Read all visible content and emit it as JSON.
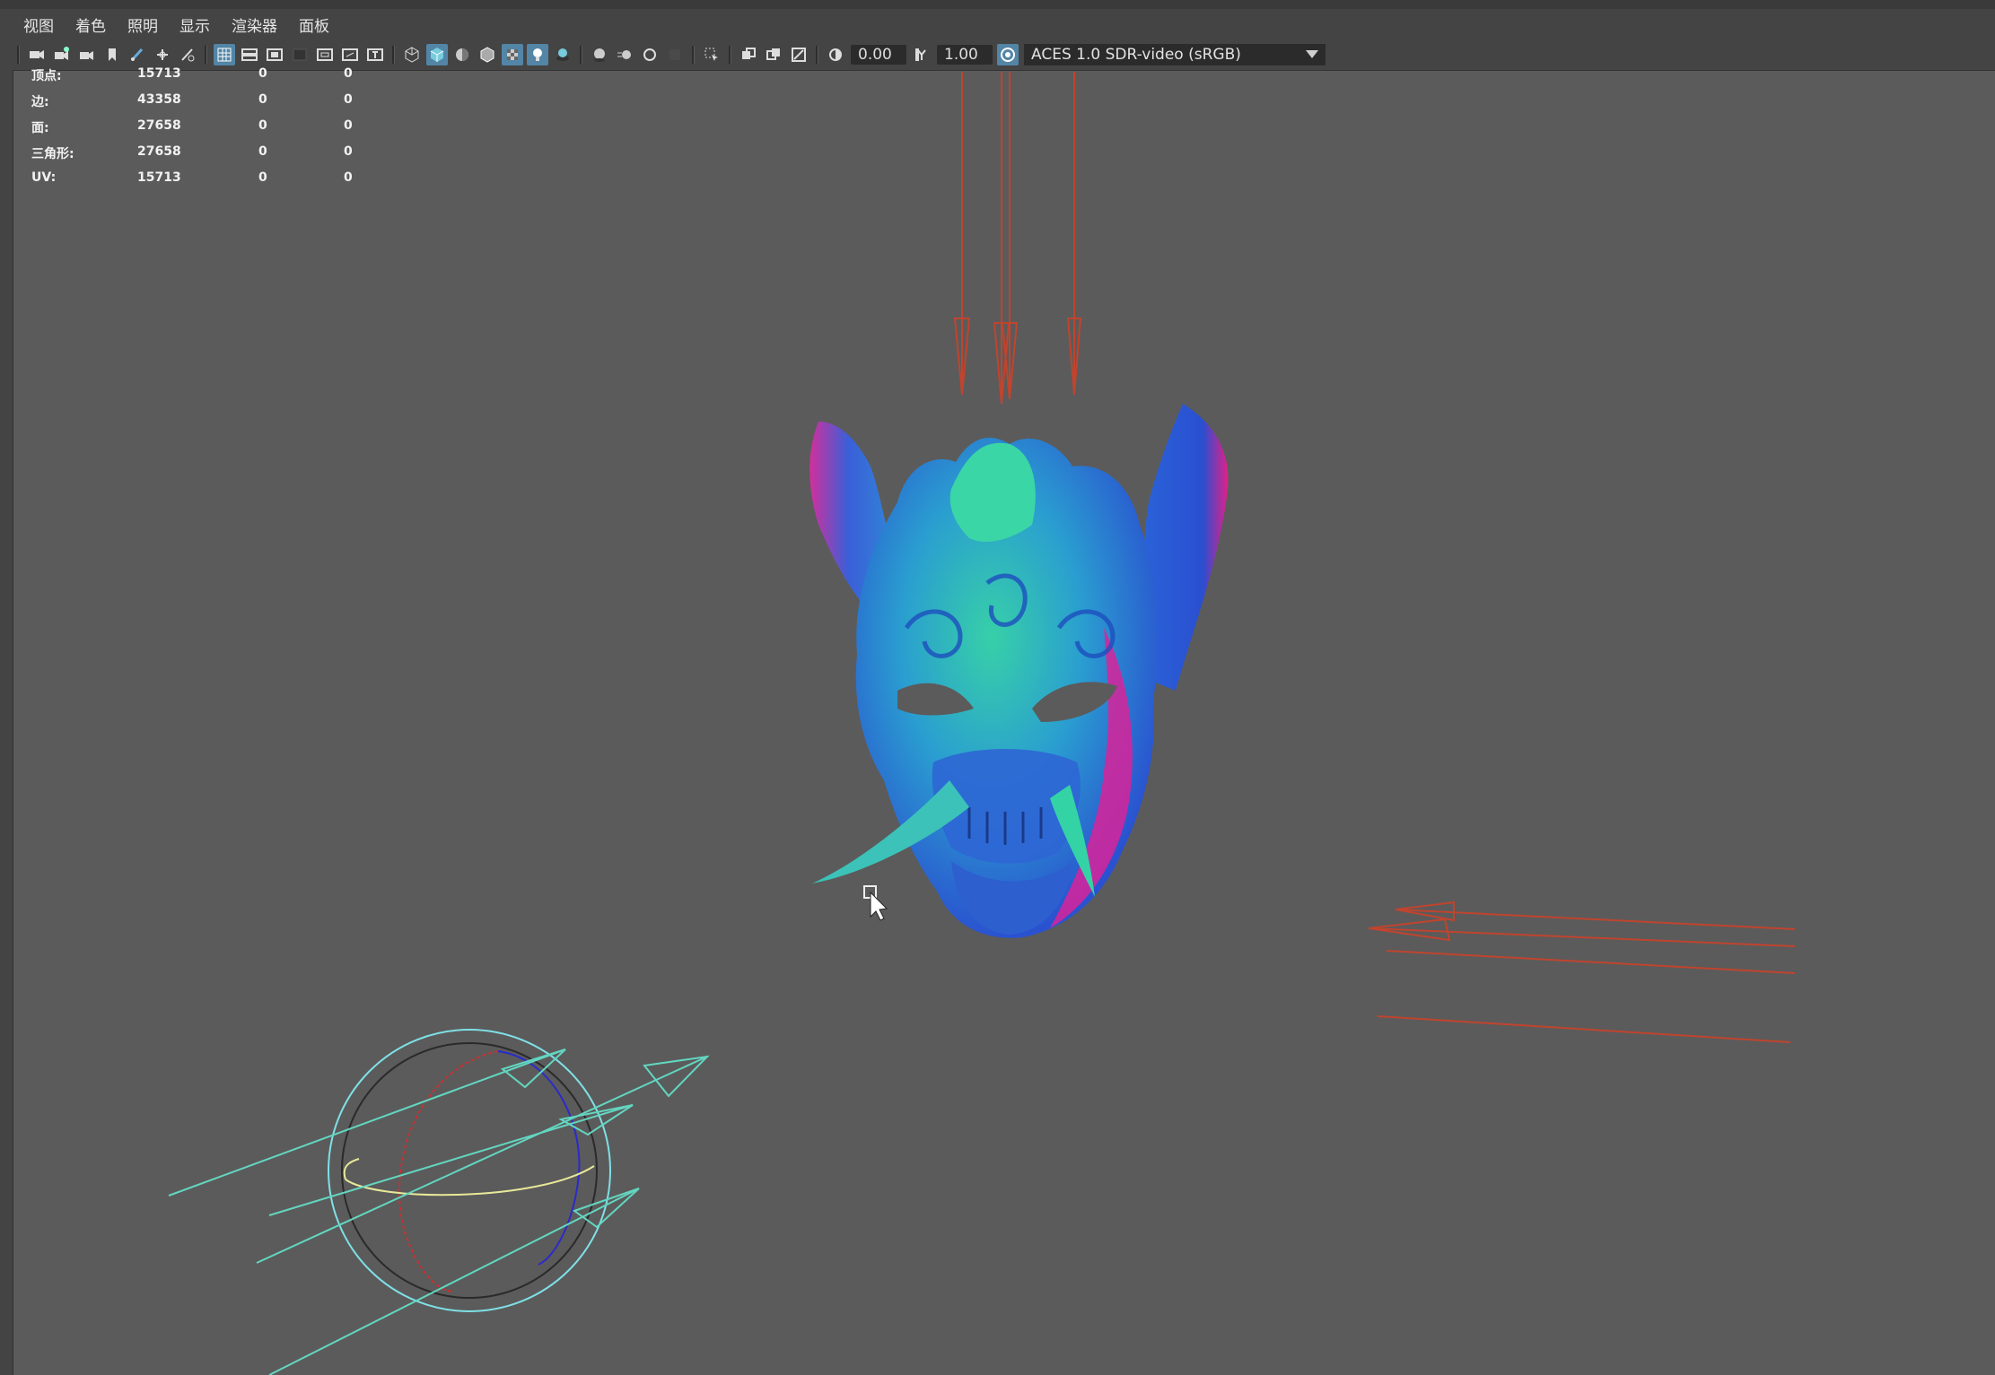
{
  "menu": [
    "视图",
    "着色",
    "照明",
    "显示",
    "渲染器",
    "面板"
  ],
  "toolbar": {
    "exposure": "0.00",
    "gamma": "1.00",
    "color_space": "ACES 1.0 SDR-video (sRGB)"
  },
  "heads_up": {
    "rows": [
      {
        "label": "顶点:",
        "values": [
          "15713",
          "0",
          "0"
        ]
      },
      {
        "label": "边:",
        "values": [
          "43358",
          "0",
          "0"
        ]
      },
      {
        "label": "面:",
        "values": [
          "27658",
          "0",
          "0"
        ]
      },
      {
        "label": "三角形:",
        "values": [
          "27658",
          "0",
          "0"
        ]
      },
      {
        "label": "UV:",
        "values": [
          "15713",
          "0",
          "0"
        ]
      }
    ]
  },
  "colors": {
    "viewport_bg": "#5b5b5b",
    "panel_bg": "#444444",
    "active_icon": "#5285a6",
    "light_red": "#c0442e",
    "light_cyan": "#63d6c0"
  }
}
